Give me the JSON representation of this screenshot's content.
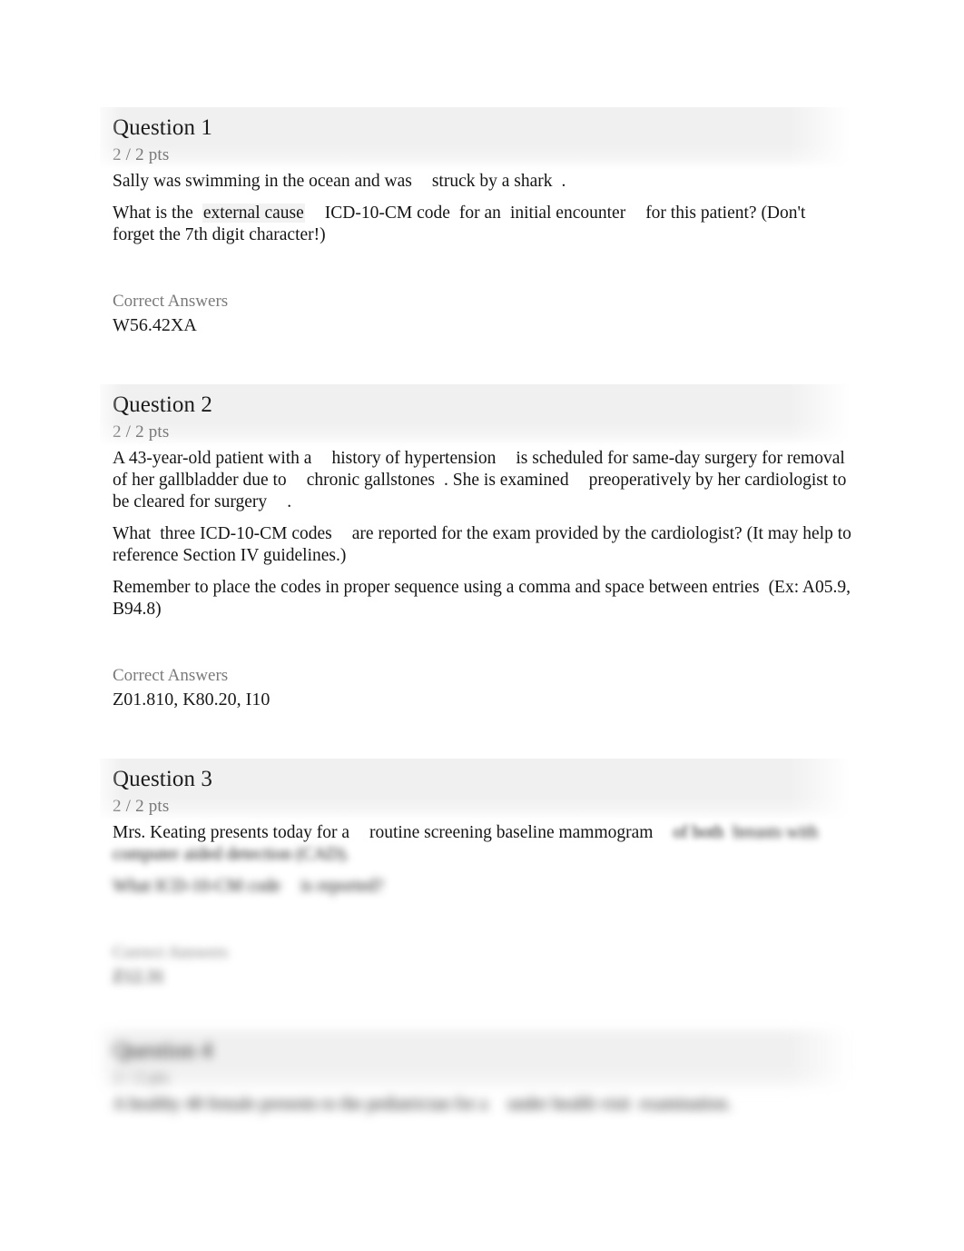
{
  "page": {
    "background_color": "#ffffff",
    "header_band_color": "#f0f0f0",
    "points_text_color": "#787878",
    "answers_label_color": "#7a7a7a",
    "body_text_color": "#151515"
  },
  "questions": [
    {
      "title": "Question 1",
      "points": "2 / 2 pts",
      "paragraphs": [
        {
          "parts": [
            {
              "text": " Sally was swimming in the ocean and was",
              "style": "plain"
            },
            {
              "text": "gap",
              "style": "gap"
            },
            {
              "text": "struck by a shark",
              "style": "plain"
            },
            {
              "text": "gap-s",
              "style": "gap-s"
            },
            {
              "text": ".",
              "style": "plain"
            }
          ]
        },
        {
          "parts": [
            {
              "text": " What is the",
              "style": "plain"
            },
            {
              "text": "gap-s",
              "style": "gap-s"
            },
            {
              "text": "external cause",
              "style": "highlight"
            },
            {
              "text": "gap",
              "style": "gap"
            },
            {
              "text": "ICD-10-CM code",
              "style": "plain"
            },
            {
              "text": "gap-s",
              "style": "gap-s"
            },
            {
              "text": "for an",
              "style": "plain"
            },
            {
              "text": "gap-s",
              "style": "gap-s"
            },
            {
              "text": "initial encounter",
              "style": "plain"
            },
            {
              "text": "gap",
              "style": "gap"
            },
            {
              "text": "for this patient? (Don't forget the 7th digit character!)",
              "style": "plain"
            }
          ]
        }
      ],
      "answers_label": "Correct Answers",
      "answers_value": "W56.42XA",
      "blurred": false
    },
    {
      "title": "Question 2",
      "points": "2 / 2 pts",
      "paragraphs": [
        {
          "parts": [
            {
              "text": " A 43-year-old patient with a",
              "style": "plain"
            },
            {
              "text": "gap",
              "style": "gap"
            },
            {
              "text": "history of hypertension",
              "style": "plain"
            },
            {
              "text": "gap",
              "style": "gap"
            },
            {
              "text": "is scheduled for same-day surgery for removal of her gallbladder due to",
              "style": "plain"
            },
            {
              "text": "gap",
              "style": "gap"
            },
            {
              "text": "chronic gallstones",
              "style": "plain"
            },
            {
              "text": "gap-s",
              "style": "gap-s"
            },
            {
              "text": ". She is examined",
              "style": "plain"
            },
            {
              "text": "gap",
              "style": "gap"
            },
            {
              "text": "preoperatively by her cardiologist to be cleared for surgery",
              "style": "plain"
            },
            {
              "text": "gap",
              "style": "gap"
            },
            {
              "text": ".",
              "style": "plain"
            }
          ]
        },
        {
          "parts": [
            {
              "text": "What",
              "style": "plain"
            },
            {
              "text": "gap-s",
              "style": "gap-s"
            },
            {
              "text": "three ICD-10-CM codes",
              "style": "plain"
            },
            {
              "text": "gap",
              "style": "gap"
            },
            {
              "text": "are reported for the exam provided by the cardiologist? (It may help to reference Section IV guidelines.)",
              "style": "plain"
            }
          ]
        },
        {
          "parts": [
            {
              "text": "Remember to place the codes in proper sequence using a comma and space between entries",
              "style": "plain"
            },
            {
              "text": "gap-s",
              "style": "gap-s"
            },
            {
              "text": "(Ex: A05.9, B94.8)",
              "style": "plain"
            }
          ]
        }
      ],
      "answers_label": "Correct Answers",
      "answers_value": "Z01.810, K80.20, I10",
      "blurred": false
    },
    {
      "title": "Question 3",
      "points": "2 / 2 pts",
      "paragraphs": [
        {
          "parts": [
            {
              "text": " Mrs. Keating presents today for a",
              "style": "plain"
            },
            {
              "text": "gap",
              "style": "gap"
            },
            {
              "text": "routine screening baseline mammogram",
              "style": "plain"
            },
            {
              "text": "gap",
              "style": "gap"
            },
            {
              "text": "of both",
              "style": "plain"
            },
            {
              "text": "gap-s",
              "style": "gap-s"
            },
            {
              "text": "breasts with computer aided detection (CAD).",
              "style": "plain"
            }
          ]
        },
        {
          "parts": [
            {
              "text": " What ICD-10-CM code",
              "style": "plain"
            },
            {
              "text": "gap",
              "style": "gap"
            },
            {
              "text": "is reported?",
              "style": "plain"
            }
          ]
        }
      ],
      "answers_label": "Correct Answers",
      "answers_value": "Z12.31",
      "blurred": true
    },
    {
      "title": "Question 4",
      "points": "2 / 2 pts",
      "paragraphs": [
        {
          "parts": [
            {
              "text": " A healthy 48 female presents to the pediatrician for a",
              "style": "plain"
            },
            {
              "text": "gap",
              "style": "gap"
            },
            {
              "text": "under health visit",
              "style": "plain"
            },
            {
              "text": "gap-s",
              "style": "gap-s"
            },
            {
              "text": "examination.",
              "style": "plain"
            }
          ]
        }
      ],
      "answers_label": "",
      "answers_value": "",
      "blurred": true
    }
  ]
}
